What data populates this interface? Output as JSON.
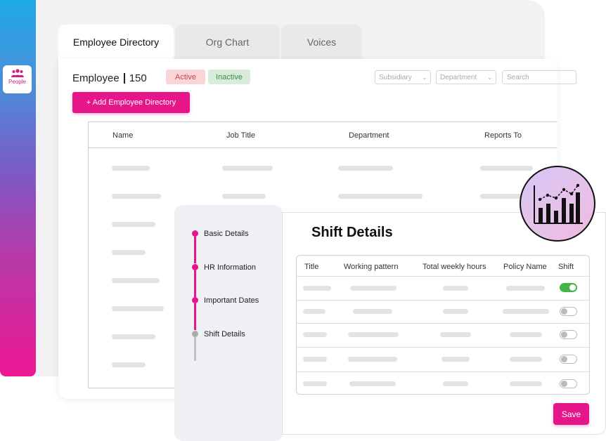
{
  "sidebar": {
    "people_label": "People",
    "people_icon": "people-icon"
  },
  "tabs": [
    {
      "label": "Employee Directory",
      "active": true
    },
    {
      "label": "Org Chart",
      "active": false
    },
    {
      "label": "Voices",
      "active": false
    }
  ],
  "header": {
    "title": "Employee",
    "count": "150",
    "active_label": "Active",
    "inactive_label": "Inactive",
    "subsidiary_placeholder": "Subsidiary",
    "department_placeholder": "Department",
    "search_placeholder": "Search",
    "add_button": "+ Add Employee Directory"
  },
  "employee_table": {
    "columns": [
      "Name",
      "Job Title",
      "Department",
      "Reports To"
    ]
  },
  "stepper": {
    "steps": [
      {
        "label": "Basic Details",
        "done": true
      },
      {
        "label": "HR Information",
        "done": true
      },
      {
        "label": "Important Dates",
        "done": true
      },
      {
        "label": "Shift Details",
        "done": false
      }
    ]
  },
  "shift_details": {
    "title": "Shift Details",
    "columns": [
      "Title",
      "Working pattern",
      "Total weekly hours",
      "Policy Name",
      "Shift"
    ],
    "shift_toggles": [
      true,
      false,
      false,
      false,
      false
    ],
    "save_button": "Save"
  },
  "colors": {
    "accent": "#e6158a",
    "toggle_on": "#43b64a",
    "active_badge_bg": "#f8d6d8",
    "inactive_badge_bg": "#d8ecd9"
  },
  "decor": {
    "analytics_icon": "bar-line-chart-icon"
  }
}
